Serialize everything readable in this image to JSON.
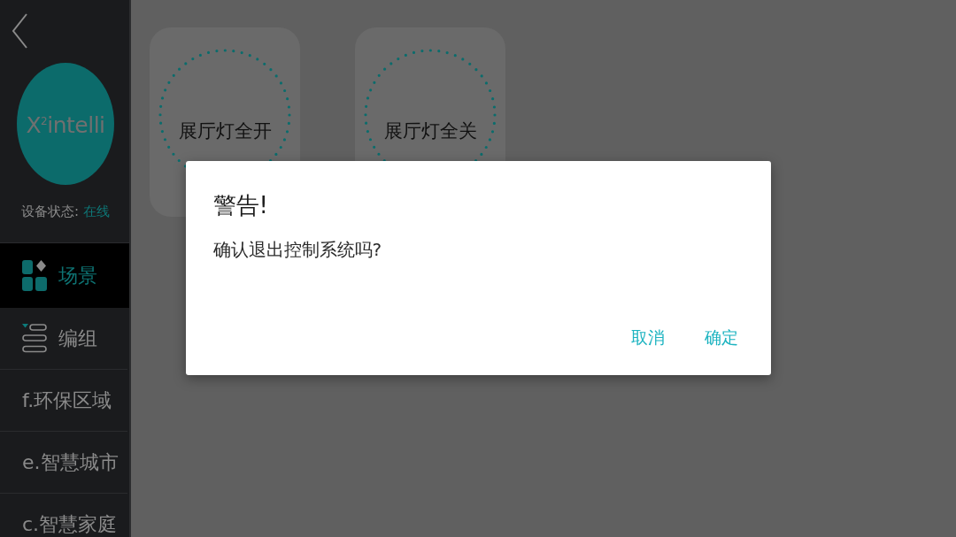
{
  "sidebar": {
    "logo": {
      "text": "X$^{2}$intelli"
    },
    "device_status": {
      "label": "设备状态:",
      "value": "在线"
    },
    "items": [
      {
        "label": "场景",
        "kind": "grid",
        "selected": true
      },
      {
        "label": "编组",
        "kind": "list",
        "selected": false
      },
      {
        "label": "f.环保区域",
        "kind": "text",
        "selected": false
      },
      {
        "label": "e.智慧城市",
        "kind": "text",
        "selected": false
      },
      {
        "label": "c.智慧家庭",
        "kind": "text",
        "selected": false
      }
    ]
  },
  "scenes": [
    {
      "label": "展厅灯全开"
    },
    {
      "label": "展厅灯全关"
    }
  ],
  "dialog": {
    "title": "警告!",
    "message": "确认退出控制系统吗?",
    "buttons": [
      "取消",
      "确定"
    ]
  }
}
